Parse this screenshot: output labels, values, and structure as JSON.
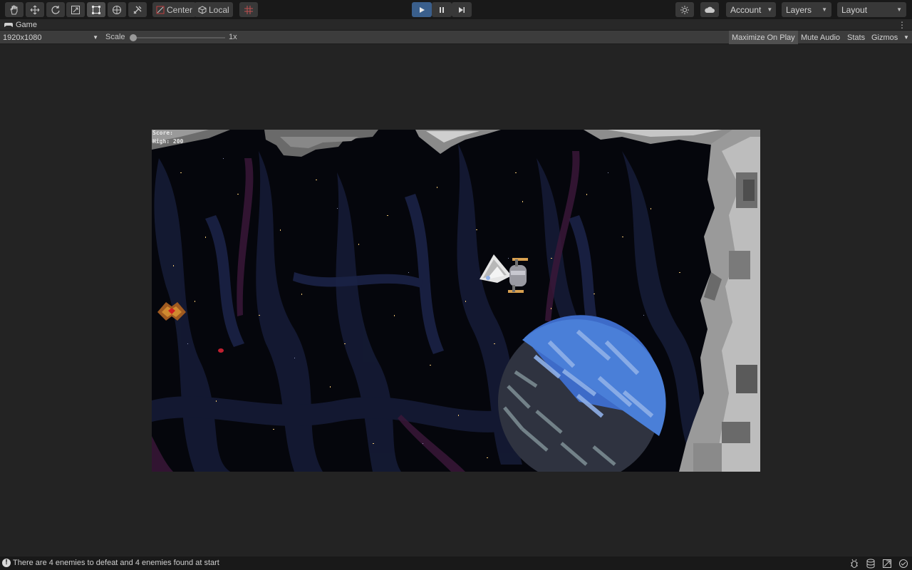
{
  "toolbar": {
    "tools": [
      {
        "name": "hand-tool",
        "icon": "hand-icon"
      },
      {
        "name": "move-tool",
        "icon": "move-icon"
      },
      {
        "name": "rotate-tool",
        "icon": "rotate-icon"
      },
      {
        "name": "scale-tool",
        "icon": "scale-icon"
      },
      {
        "name": "rect-tool",
        "icon": "rect-icon"
      },
      {
        "name": "transform-tool",
        "icon": "transform-icon"
      },
      {
        "name": "custom-tool",
        "icon": "tools-icon"
      }
    ],
    "pivot_center": "Center",
    "pivot_local": "Local",
    "account": "Account",
    "layers": "Layers",
    "layout": "Layout"
  },
  "tab": {
    "label": "Game"
  },
  "gamebar": {
    "resolution": "1920x1080",
    "scale_label": "Scale",
    "scale_value": "1x",
    "maximize": "Maximize On Play",
    "mute": "Mute Audio",
    "stats": "Stats",
    "gizmos": "Gizmos"
  },
  "hud": {
    "score": "Score:",
    "high": "High: 200"
  },
  "status": {
    "message": "There are 4 enemies to defeat and 4 enemies found at start"
  },
  "colors": {
    "accent": "#3a5f8c",
    "toolbar_bg": "#191919"
  }
}
